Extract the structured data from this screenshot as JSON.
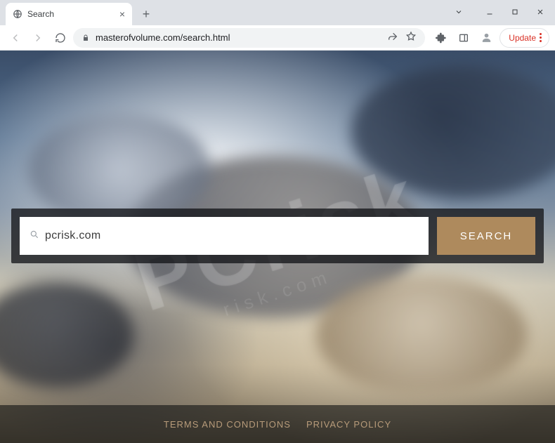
{
  "window": {
    "tab_title": "Search"
  },
  "browser": {
    "url": "masterofvolume.com/search.html",
    "update_label": "Update"
  },
  "page": {
    "search_value": "pcrisk.com",
    "search_button": "SEARCH",
    "footer": {
      "terms": "TERMS AND CONDITIONS",
      "privacy": "PRIVACY POLICY"
    }
  },
  "watermark": {
    "main": "PCrisk",
    "sub": "risk.com"
  }
}
